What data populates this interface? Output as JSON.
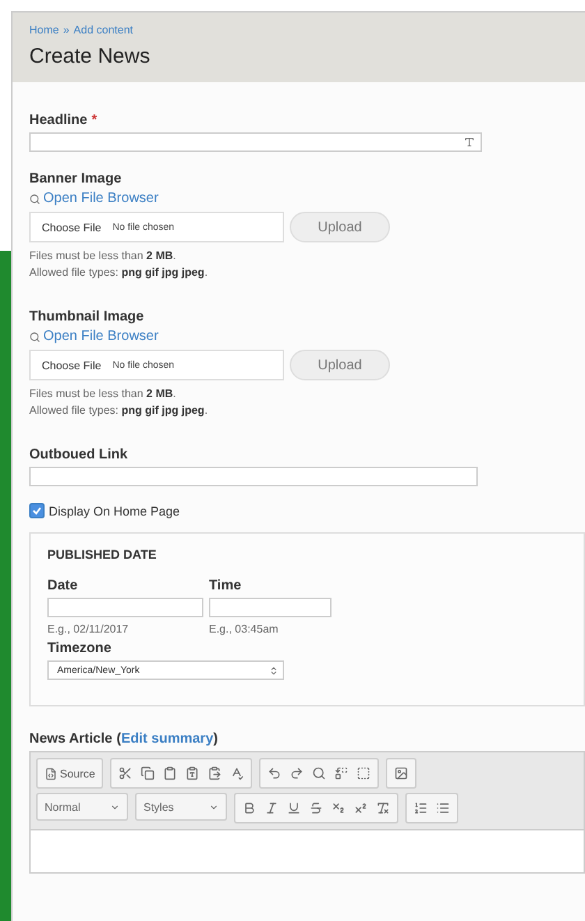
{
  "breadcrumb": [
    {
      "label": "Home"
    },
    {
      "label": "Add content"
    }
  ],
  "breadcrumb_separator": "»",
  "page_title": "Create News",
  "headline": {
    "label": "Headline",
    "required_mark": "*"
  },
  "uploads": [
    {
      "label": "Banner Image",
      "browser_link": "Open File Browser",
      "choose_button": "Choose File",
      "file_status": "No file chosen",
      "upload_button": "Upload",
      "hint_size": "Files must be less than **2 MB**.",
      "hint_types": "Allowed file types: **png gif jpg jpeg**."
    },
    {
      "label": "Thumbnail Image",
      "browser_link": "Open File Browser",
      "choose_button": "Choose File",
      "file_status": "No file chosen",
      "upload_button": "Upload",
      "hint_size": "Files must be less than **2 MB**.",
      "hint_types": "Allowed file types: **png gif jpg jpeg**."
    }
  ],
  "outbound_link": {
    "label": "Outboued Link"
  },
  "display_on_home": {
    "label": "Display On Home Page",
    "checked": true
  },
  "published_date": {
    "legend": "PUBLISHED DATE",
    "date_label": "Date",
    "date_hint": "E.g., 02/11/2017",
    "time_label": "Time",
    "time_hint": "E.g., 03:45am",
    "timezone_label": "Timezone",
    "timezone_value": "America/New_York"
  },
  "news_article": {
    "label": "News Article",
    "paren_open": "(",
    "link": "Edit summary",
    "paren_close": ")",
    "source_button": "Source",
    "format_select": "Normal",
    "styles_select": "Styles"
  }
}
